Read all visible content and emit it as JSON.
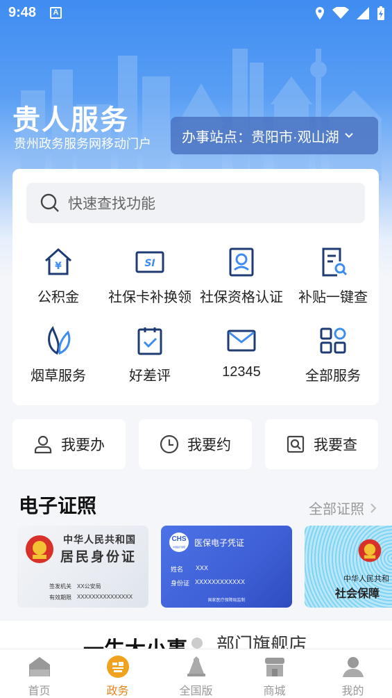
{
  "status_bar": {
    "time": "9:48",
    "notification_letter": "A"
  },
  "header": {
    "title": "贵人服务",
    "subtitle": "贵州政务服务网移动门户",
    "station_label": "办事站点：贵阳市·观山湖"
  },
  "search": {
    "placeholder": "快速查找功能"
  },
  "services": [
    {
      "label": "公积金",
      "icon": "housing-fund-icon"
    },
    {
      "label": "社保卡补换领",
      "icon": "social-card-icon"
    },
    {
      "label": "社保资格认证",
      "icon": "certification-icon"
    },
    {
      "label": "补贴一键查",
      "icon": "subsidy-search-icon"
    },
    {
      "label": "烟草服务",
      "icon": "tobacco-leaf-icon"
    },
    {
      "label": "好差评",
      "icon": "clipboard-check-icon"
    },
    {
      "label": "12345",
      "icon": "mail-icon"
    },
    {
      "label": "全部服务",
      "icon": "grid-apps-icon"
    }
  ],
  "actions": [
    {
      "label": "我要办",
      "icon": "person-icon"
    },
    {
      "label": "我要约",
      "icon": "clock-icon"
    },
    {
      "label": "我要查",
      "icon": "search-doc-icon"
    }
  ],
  "certificates": {
    "title": "电子证照",
    "more": "全部证照",
    "id_card": {
      "line1": "中华人民共和国",
      "line2": "居民身份证",
      "issuer_label": "签发机关",
      "issuer_value": "XX公安局",
      "valid_label": "有效期限",
      "valid_value": "XXXXXXXXXXXXXXX"
    },
    "medical": {
      "logo": "CHS",
      "logo_sub": "中国医疗保障",
      "title": "医保电子凭证",
      "name_label": "姓名",
      "name_value": "XXX",
      "id_label": "身份证",
      "id_value": "XXXXXXXXXXXX",
      "footer": "国家医疗保障局监制"
    },
    "social": {
      "line1": "中华人民共和",
      "line2": "社会保障"
    }
  },
  "promo": {
    "left": "一生大小事",
    "right": "部门旗舰店"
  },
  "tabs": [
    {
      "label": "首页",
      "icon": "home-icon",
      "active": false
    },
    {
      "label": "政务",
      "icon": "gov-badge-icon",
      "active": true
    },
    {
      "label": "全国版",
      "icon": "bell-icon",
      "active": false
    },
    {
      "label": "商城",
      "icon": "shop-icon",
      "active": false
    },
    {
      "label": "我的",
      "icon": "user-icon",
      "active": false
    }
  ],
  "colors": {
    "primary_blue": "#3f8cf1",
    "icon_navy": "#1f3b73",
    "active_tab": "#e8841a",
    "background": "#f4f6f9"
  }
}
